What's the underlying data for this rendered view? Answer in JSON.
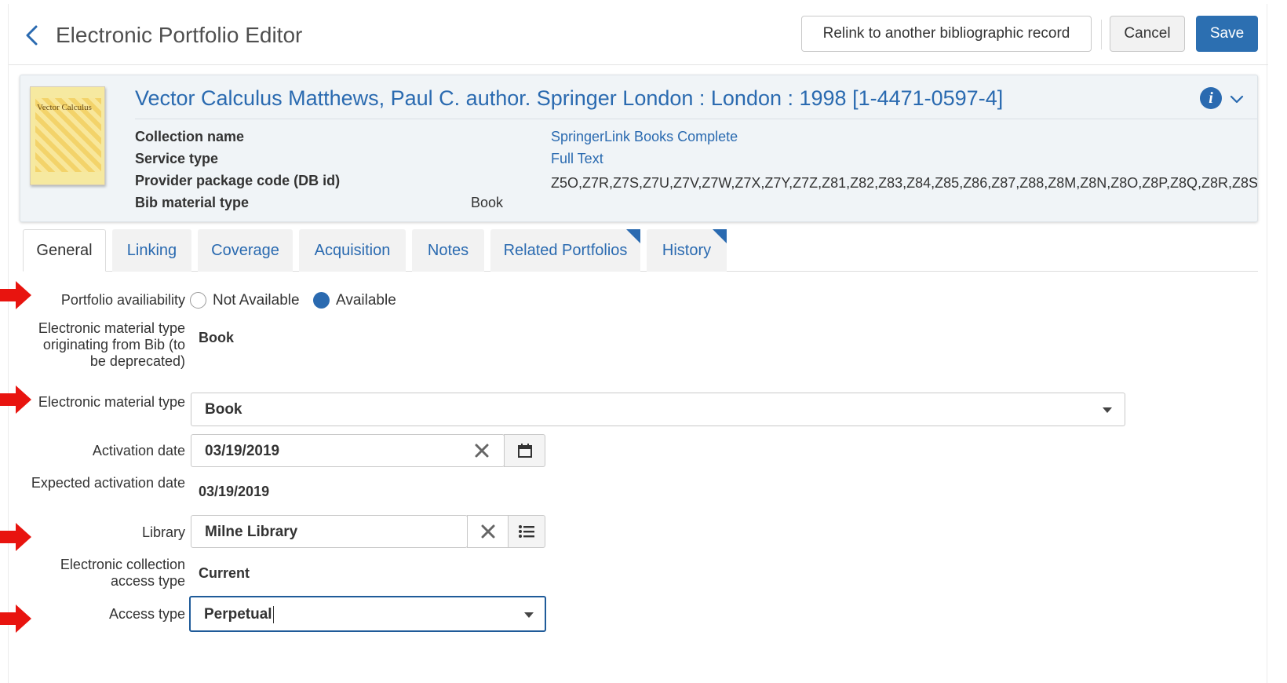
{
  "header": {
    "title": "Electronic Portfolio Editor",
    "relink_label": "Relink to another bibliographic record",
    "cancel_label": "Cancel",
    "save_label": "Save"
  },
  "record": {
    "title": "Vector Calculus Matthews, Paul C. author. Springer London : London : 1998 [1-4471-0597-4]",
    "thumbnail_title": "Vector Calculus",
    "collection_name_label": "Collection name",
    "collection_name_value": "SpringerLink Books Complete",
    "service_type_label": "Service type",
    "service_type_value": "Full Text",
    "provider_code_label": "Provider package code (DB id)",
    "provider_code_value": "Z5O,Z7R,Z7S,Z7U,Z7V,Z7W,Z7X,Z7Y,Z7Z,Z81,Z82,Z83,Z84,Z85,Z86,Z87,Z88,Z8M,Z8N,Z8O,Z8P,Z8Q,Z8R,Z8S",
    "bib_material_label": "Bib material type",
    "bib_material_value": "Book"
  },
  "tabs": [
    {
      "label": "General",
      "active": true
    },
    {
      "label": "Linking"
    },
    {
      "label": "Coverage"
    },
    {
      "label": "Acquisition"
    },
    {
      "label": "Notes"
    },
    {
      "label": "Related Portfolios"
    },
    {
      "label": "History"
    }
  ],
  "form": {
    "availability_label": "Portfolio availiability",
    "availability_options": [
      "Not Available",
      "Available"
    ],
    "availability_selected": "Available",
    "origin_material_label": "Electronic material type originating from Bib (to be deprecated)",
    "origin_material_value": "Book",
    "material_type_label": "Electronic material type",
    "material_type_value": "Book",
    "activation_date_label": "Activation date",
    "activation_date_value": "03/19/2019",
    "expected_activation_label": "Expected activation date",
    "expected_activation_value": "03/19/2019",
    "library_label": "Library",
    "library_value": "Milne Library",
    "collection_access_label": "Electronic collection access type",
    "collection_access_value": "Current",
    "access_type_label": "Access type",
    "access_type_value": "Perpetual"
  },
  "colors": {
    "accent": "#2a6ab0",
    "save": "#2c6fb1",
    "annotation_arrow": "#e8140f"
  }
}
